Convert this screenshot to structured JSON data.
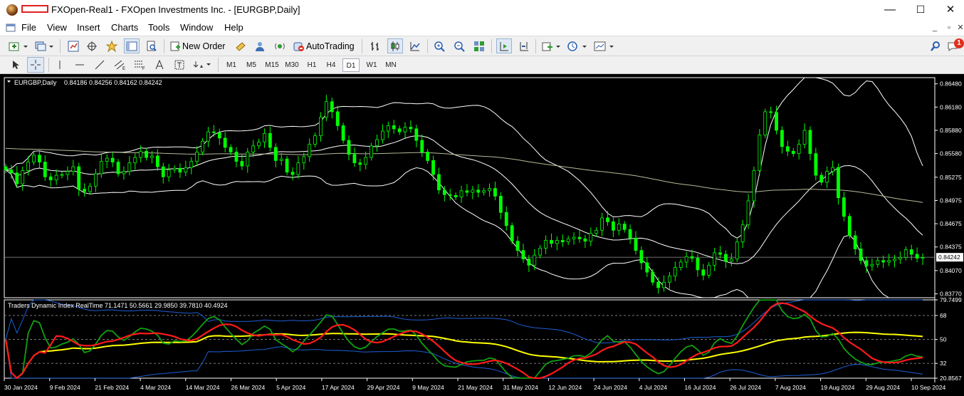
{
  "window": {
    "title": "FXOpen-Real1 - FXOpen Investments Inc. - [EURGBP,Daily]",
    "controls": {
      "minimize": "—",
      "maximize": "☐",
      "close": "✕"
    }
  },
  "menu": {
    "items": [
      "File",
      "View",
      "Insert",
      "Charts",
      "Tools",
      "Window",
      "Help"
    ],
    "mdi_controls": [
      "_",
      "▫",
      "✕"
    ]
  },
  "toolbar": {
    "new_order_label": "New Order",
    "autotrading_label": "AutoTrading",
    "notification_count": "1"
  },
  "timeframes": {
    "items": [
      "M1",
      "M5",
      "M15",
      "M30",
      "H1",
      "H4",
      "D1",
      "W1",
      "MN"
    ],
    "active": "D1"
  },
  "chart": {
    "symbol_label": "EURGBP,Daily",
    "ohlc": "0.84186 0.84256 0.84162 0.84242",
    "current_price": "0.84242",
    "price_scale": [
      "0.86480",
      "0.86180",
      "0.85880",
      "0.85580",
      "0.85275",
      "0.84975",
      "0.84675",
      "0.84375",
      "0.84070",
      "0.83770"
    ],
    "indicator_label": "Traders Dynamic Index RealTime 71.1471 50.5661 29.9850 39.7810 40.4924",
    "indicator_scale": [
      "79.7499",
      "68",
      "50",
      "32",
      "20.8567"
    ],
    "date_labels": [
      "30 Jan 2024",
      "9 Feb 2024",
      "21 Feb 2024",
      "4 Mar 2024",
      "14 Mar 2024",
      "26 Mar 2024",
      "5 Apr 2024",
      "17 Apr 2024",
      "29 Apr 2024",
      "9 May 2024",
      "21 May 2024",
      "31 May 2024",
      "12 Jun 2024",
      "24 Jun 2024",
      "4 Jul 2024",
      "16 Jul 2024",
      "26 Jul 2024",
      "7 Aug 2024",
      "19 Aug 2024",
      "29 Aug 2024",
      "10 Sep 2024"
    ],
    "colors": {
      "background": "#000000",
      "candle": "#00ff00",
      "bands": "#ffffff",
      "ma_long": "#b8b89a",
      "tdi_green": "#11a011",
      "tdi_red": "#ff1a1a",
      "tdi_yellow": "#ffff00",
      "tdi_blue": "#1e5fd6"
    }
  },
  "chart_data": {
    "type": "candlestick",
    "title": "EURGBP,Daily",
    "ylim": [
      0.8372,
      0.8656
    ],
    "closes": [
      0.8537,
      0.8533,
      0.8519,
      0.8536,
      0.8547,
      0.8556,
      0.8547,
      0.8528,
      0.8524,
      0.853,
      0.8531,
      0.8535,
      0.8541,
      0.8512,
      0.8509,
      0.8516,
      0.8532,
      0.8548,
      0.8552,
      0.8547,
      0.8532,
      0.8535,
      0.8546,
      0.8553,
      0.8561,
      0.8553,
      0.8555,
      0.8541,
      0.8528,
      0.8537,
      0.8539,
      0.8534,
      0.854,
      0.8548,
      0.856,
      0.8574,
      0.8586,
      0.8585,
      0.8578,
      0.8566,
      0.856,
      0.8548,
      0.8542,
      0.856,
      0.8568,
      0.8573,
      0.8584,
      0.8566,
      0.8549,
      0.8551,
      0.8534,
      0.8531,
      0.8546,
      0.8554,
      0.857,
      0.8581,
      0.8605,
      0.8625,
      0.8612,
      0.8594,
      0.8575,
      0.8557,
      0.8546,
      0.8544,
      0.8553,
      0.8568,
      0.8576,
      0.8587,
      0.8594,
      0.859,
      0.8586,
      0.8592,
      0.859,
      0.8575,
      0.856,
      0.8549,
      0.8531,
      0.8511,
      0.8505,
      0.8504,
      0.8502,
      0.851,
      0.8508,
      0.8511,
      0.8508,
      0.851,
      0.8513,
      0.8503,
      0.8482,
      0.8465,
      0.8445,
      0.8433,
      0.8422,
      0.8414,
      0.8427,
      0.8436,
      0.8446,
      0.8442,
      0.8446,
      0.8444,
      0.8448,
      0.845,
      0.8448,
      0.8445,
      0.8455,
      0.8459,
      0.8475,
      0.847,
      0.8459,
      0.8467,
      0.846,
      0.8449,
      0.8433,
      0.8417,
      0.8405,
      0.8392,
      0.8385,
      0.8392,
      0.84,
      0.8411,
      0.8418,
      0.8425,
      0.8423,
      0.8408,
      0.8401,
      0.8414,
      0.843,
      0.8428,
      0.8419,
      0.8422,
      0.8444,
      0.8466,
      0.8497,
      0.8536,
      0.8582,
      0.8612,
      0.8611,
      0.8588,
      0.8567,
      0.8561,
      0.8558,
      0.857,
      0.8588,
      0.8558,
      0.853,
      0.8521,
      0.8535,
      0.854,
      0.8501,
      0.8477,
      0.8452,
      0.8435,
      0.842,
      0.8413,
      0.8415,
      0.842,
      0.8418,
      0.842,
      0.8422,
      0.8424,
      0.8434,
      0.8428,
      0.8423,
      0.8424
    ]
  }
}
